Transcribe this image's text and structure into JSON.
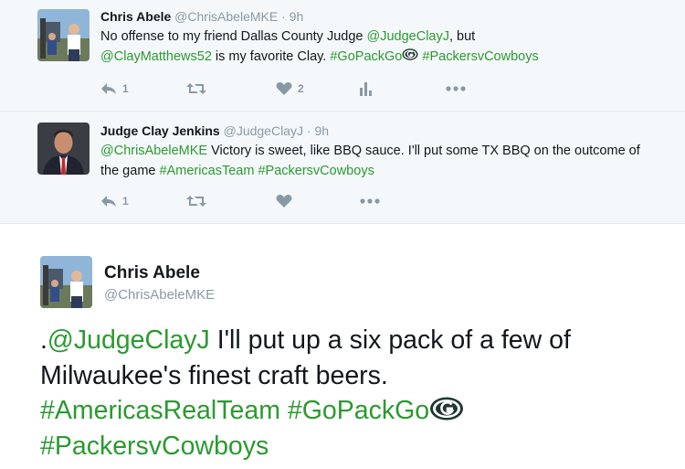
{
  "replies": [
    {
      "name": "Chris Abele",
      "handle": "@ChrisAbeleMKE",
      "dot": "·",
      "time": "9h",
      "text_parts": {
        "p1": "No offense to my friend Dallas County Judge ",
        "mention1": "@JudgeClayJ",
        "p2": ", but",
        "mention2": "@ClayMatthews52",
        "p3": " is my favorite Clay. ",
        "hashtag1": "#GoPackGo",
        "hashtag2": "#PackersvCowboys"
      },
      "actions": {
        "reply_count": "1",
        "retweet_count": "",
        "like_count": "2"
      }
    },
    {
      "name": "Judge Clay Jenkins",
      "handle": "@JudgeClayJ",
      "dot": "·",
      "time": "9h",
      "text_parts": {
        "mention1": "@ChrisAbeleMKE",
        "p1": " Victory is sweet, like BBQ sauce. I'll put some TX BBQ on the outcome of the game ",
        "hashtag1": "#AmericasTeam",
        "hashtag2": "#PackersvCowboys"
      },
      "actions": {
        "reply_count": "1",
        "retweet_count": "",
        "like_count": ""
      }
    }
  ],
  "main_tweet": {
    "name": "Chris Abele",
    "handle": "@ChrisAbeleMKE",
    "text_parts": {
      "dot_prefix": ".",
      "mention1": "@JudgeClayJ",
      "p1": " I'll put up a six pack of a few of Milwaukee's finest craft beers.",
      "hashtag1": "#AmericasRealTeam",
      "hashtag2": "#GoPackGo",
      "hashtag3": "#PackersvCowboys"
    }
  },
  "colors": {
    "link": "#2a9a30",
    "muted": "#8899a6",
    "reply_bg": "#f5f8fa",
    "text": "#14171a",
    "packers_green": "#203731",
    "packers_gold": "#ffb612"
  },
  "icons": [
    "reply-icon",
    "retweet-icon",
    "like-icon",
    "analytics-icon",
    "more-icon",
    "packers-logo-icon"
  ]
}
